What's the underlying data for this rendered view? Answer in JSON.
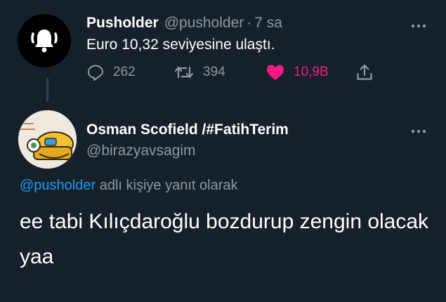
{
  "original_tweet": {
    "author_name": "Pusholder",
    "author_handle": "@pusholder",
    "separator": "·",
    "time_ago": "7 sa",
    "text": "Euro 10,32 seviyesine ulaştı.",
    "more_icon": "more-horizontal-icon",
    "actions": {
      "reply_count": "262",
      "retweet_count": "394",
      "like_count": "10,9B"
    },
    "colors": {
      "like": "#f91880",
      "muted": "#8b98a5"
    }
  },
  "reply_tweet": {
    "author_name": "Osman Scofield /#FatihTerim",
    "author_handle": "@birazyavsagim",
    "reply_context_link": "@pusholder",
    "reply_context_text": "adlı kişiye yanıt olarak",
    "text": "ee tabi Kılıçdaroğlu bozdurup zengin olacak yaa",
    "more_icon": "more-horizontal-icon"
  },
  "theme": {
    "background": "#15202b",
    "link": "#1d9bf0"
  }
}
